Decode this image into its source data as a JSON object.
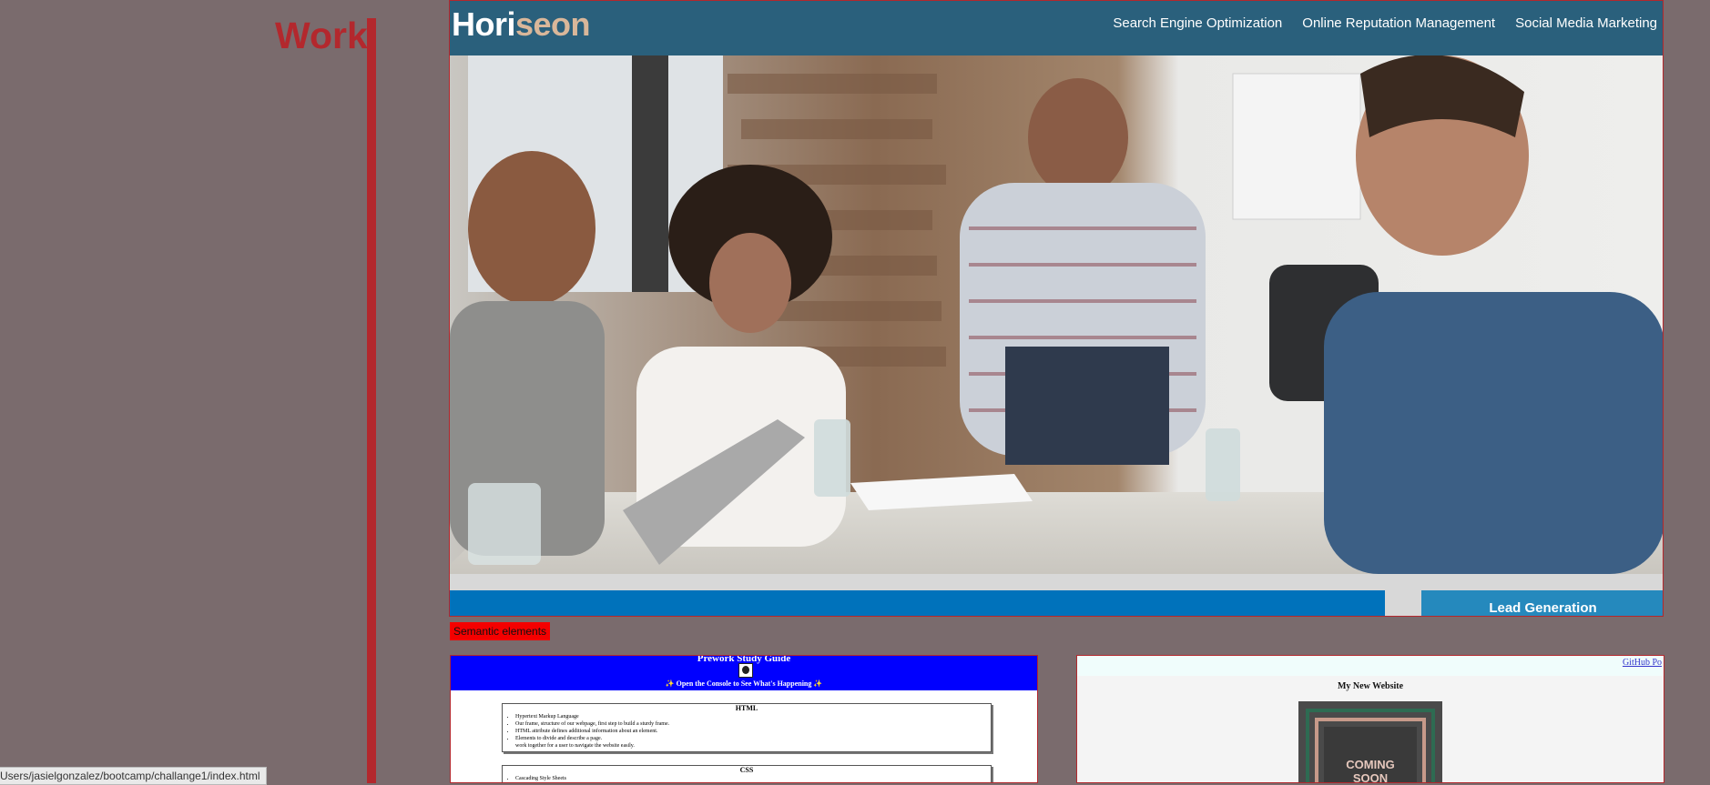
{
  "page": {
    "section_title": "Work"
  },
  "featured": {
    "logo_prefix": "Hori",
    "logo_suffix": "seon",
    "nav": [
      "Search Engine Optimization",
      "Online Reputation Management",
      "Social Media Marketing"
    ],
    "lead_label": "Lead Generation",
    "caption": "Semantic elements",
    "colors": {
      "header": "#2a607c",
      "logo_accent": "#d9b79a",
      "strip": "#0072bb",
      "lead": "#2589bd"
    }
  },
  "prework": {
    "title": "Prework Study Guide",
    "subtitle": "✨ Open the Console to See What's Happening ✨",
    "html_heading": "HTML",
    "html_items": [
      "Hypertext Markup Language",
      "Our frame, structure of our webpage, first step to build a sturdy frame.",
      "HTML attribute defines additional information about an element.",
      "Elements to divide and describe a page.",
      "work together for a user to navigate the website easily."
    ],
    "css_heading": "CSS",
    "css_items": [
      "Cascading Style Sheets"
    ]
  },
  "newsite": {
    "link": "GitHub Po",
    "title": "My New Website",
    "sign_line1": "COMING",
    "sign_line2": "SOON"
  },
  "status_bar": {
    "url": "Users/jasielgonzalez/bootcamp/challange1/index.html"
  }
}
